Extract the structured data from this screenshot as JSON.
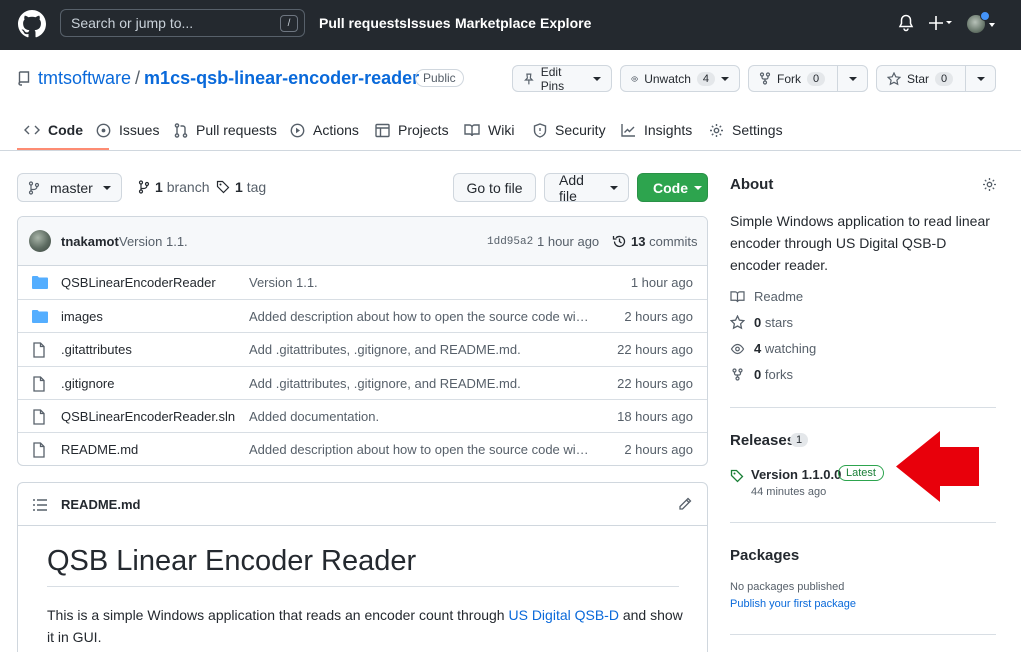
{
  "header": {
    "search_placeholder": "Search or jump to...",
    "search_shortcut": "/",
    "nav": [
      "Pull requests",
      "Issues",
      "Marketplace",
      "Explore"
    ]
  },
  "repo": {
    "owner": "tmtsoftware",
    "separator": "/",
    "name": "m1cs-qsb-linear-encoder-reader",
    "visibility": "Public",
    "edit_pins_label": "Edit Pins",
    "unwatch_label": "Unwatch",
    "unwatch_count": "4",
    "fork_label": "Fork",
    "fork_count": "0",
    "star_label": "Star",
    "star_count": "0"
  },
  "tabs": [
    {
      "label": "Code",
      "icon": "code-icon",
      "active": true
    },
    {
      "label": "Issues",
      "icon": "issue-icon"
    },
    {
      "label": "Pull requests",
      "icon": "pull-request-icon"
    },
    {
      "label": "Actions",
      "icon": "play-icon"
    },
    {
      "label": "Projects",
      "icon": "table-icon"
    },
    {
      "label": "Wiki",
      "icon": "book-icon"
    },
    {
      "label": "Security",
      "icon": "shield-icon"
    },
    {
      "label": "Insights",
      "icon": "graph-icon"
    },
    {
      "label": "Settings",
      "icon": "gear-icon"
    }
  ],
  "toolbar": {
    "branch": "master",
    "branches_count": "1",
    "branches_label": "branch",
    "tags_count": "1",
    "tags_label": "tag",
    "goto_file": "Go to file",
    "add_file": "Add file",
    "code": "Code"
  },
  "commit": {
    "author": "tnakamot",
    "message": "Version 1.1.",
    "sha": "1dd95a2",
    "time": "1 hour ago",
    "count": "13",
    "count_label": "commits"
  },
  "files": [
    {
      "name": "QSBLinearEncoderReader",
      "type": "dir",
      "message": "Version 1.1.",
      "time": "1 hour ago"
    },
    {
      "name": "images",
      "type": "dir",
      "message": "Added description about how to open the source code wit…",
      "time": "2 hours ago"
    },
    {
      "name": ".gitattributes",
      "type": "file",
      "message": "Add .gitattributes, .gitignore, and README.md.",
      "time": "22 hours ago"
    },
    {
      "name": ".gitignore",
      "type": "file",
      "message": "Add .gitattributes, .gitignore, and README.md.",
      "time": "22 hours ago"
    },
    {
      "name": "QSBLinearEncoderReader.sln",
      "type": "file",
      "message": "Added documentation.",
      "time": "18 hours ago"
    },
    {
      "name": "README.md",
      "type": "file",
      "message": "Added description about how to open the source code wit…",
      "time": "2 hours ago"
    }
  ],
  "readme": {
    "filename": "README.md",
    "title": "QSB Linear Encoder Reader",
    "para_before": "This is a simple Windows application that reads an encoder count through ",
    "para_link": "US Digital QSB-D",
    "para_after": " and show it in GUI."
  },
  "about": {
    "heading": "About",
    "description": "Simple Windows application to read linear encoder through US Digital QSB-D encoder reader.",
    "readme": "Readme",
    "stars_count": "0",
    "stars_label": "stars",
    "watching_count": "4",
    "watching_label": "watching",
    "forks_count": "0",
    "forks_label": "forks"
  },
  "releases": {
    "heading": "Releases",
    "count": "1",
    "latest_name": "Version 1.1.0.0",
    "latest_badge": "Latest",
    "latest_time": "44 minutes ago"
  },
  "packages": {
    "heading": "Packages",
    "none_text": "No packages published",
    "publish_link": "Publish your first package"
  },
  "colors": {
    "header_bg": "#24292f",
    "link": "#0969da",
    "primary_button": "#2da44e",
    "tab_underline": "#fd8c73",
    "annotation_arrow": "#e8000b"
  }
}
